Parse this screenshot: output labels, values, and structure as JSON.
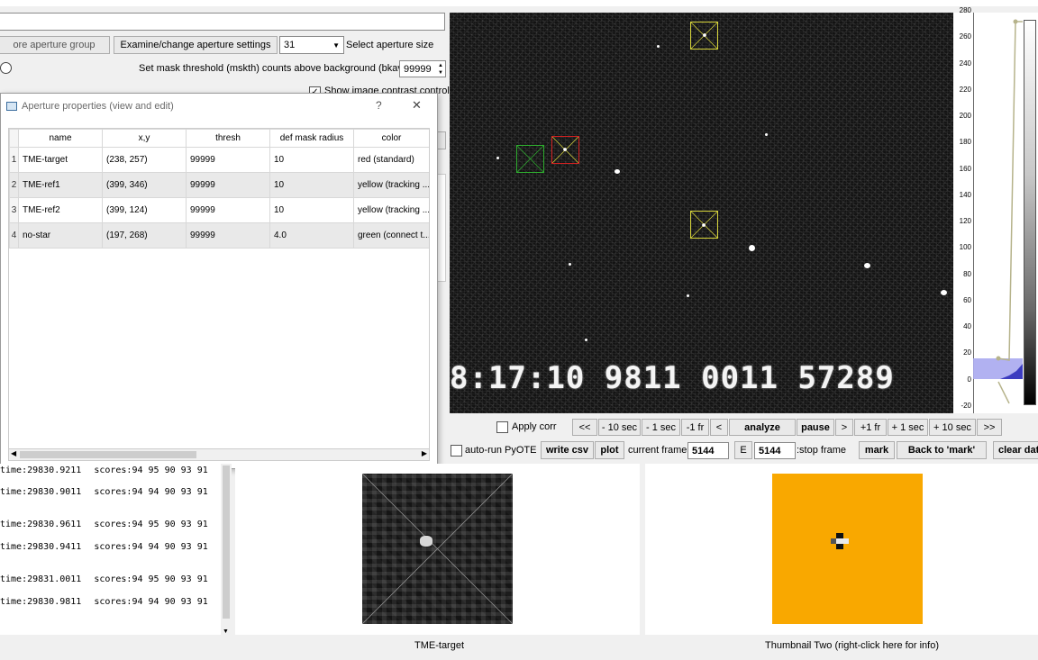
{
  "top": {
    "group_button": "ore aperture group",
    "examine_button": "Examine/change aperture settings",
    "aperture_size_value": "31",
    "aperture_size_label": "Select aperture size",
    "mask_threshold_label": "Set mask threshold (mskth) counts above background (bkavg)",
    "mask_threshold_value": "99999",
    "show_contrast_label": "Show image contrast control"
  },
  "dialog": {
    "title": "Aperture properties (view and edit)",
    "help": "?",
    "close": "✕",
    "columns": [
      "name",
      "x,y",
      "thresh",
      "def mask radius",
      "color"
    ],
    "rows": [
      {
        "num": "1",
        "name": "TME-target",
        "xy": "(238, 257)",
        "thresh": "99999",
        "radius": "10",
        "color": "red (standard)"
      },
      {
        "num": "2",
        "name": "TME-ref1",
        "xy": "(399, 346)",
        "thresh": "99999",
        "radius": "10",
        "color": "yellow (tracking ..."
      },
      {
        "num": "3",
        "name": "TME-ref2",
        "xy": "(399, 124)",
        "thresh": "99999",
        "radius": "10",
        "color": "yellow (tracking ..."
      },
      {
        "num": "4",
        "name": "no-star",
        "xy": "(197, 268)",
        "thresh": "99999",
        "radius": "4.0",
        "color": "green (connect t..."
      }
    ]
  },
  "image": {
    "timestamp": "8:17:10 9811 0011 57289"
  },
  "histogram": {
    "y_labels": [
      "280",
      "260",
      "240",
      "220",
      "200",
      "180",
      "160",
      "140",
      "120",
      "100",
      "80",
      "60",
      "40",
      "20",
      "0",
      "-20"
    ]
  },
  "controls": {
    "apply_corr": "Apply corr",
    "nav": [
      "<<",
      "- 10 sec",
      "- 1 sec",
      "-1 fr",
      "<"
    ],
    "analyze": "analyze",
    "pause": "pause",
    "nav_fwd": [
      ">",
      "+1 fr",
      "+ 1 sec",
      "+ 10 sec",
      ">>"
    ],
    "auto_run": "auto-run PyOTE",
    "write_csv": "write csv",
    "plot": "plot",
    "current_frame_label": "current frame:",
    "current_frame_value": "5144",
    "e_label": "E",
    "stop_frame_value": "5144",
    "stop_frame_label": ":stop frame",
    "mark": "mark",
    "back_to_mark": "Back to 'mark'",
    "clear_data": "clear dat"
  },
  "log": [
    {
      "time": "time:29830.9211",
      "scores": "scores:94 95 90 93 91"
    },
    {
      "time": "time:29830.9011",
      "scores": "scores:94 94 90 93 91"
    },
    {
      "time": "time:29830.9611",
      "scores": "scores:94 95 90 93 91"
    },
    {
      "time": "time:29830.9411",
      "scores": "scores:94 94 90 93 91"
    },
    {
      "time": "time:29831.0011",
      "scores": "scores:94 95 90 93 91"
    },
    {
      "time": "time:29830.9811",
      "scores": "scores:94 94 90 93 91"
    }
  ],
  "thumbnails": {
    "one_label": "TME-target",
    "two_label": "Thumbnail Two (right-click here for info)",
    "two_color": "#f9a800"
  }
}
